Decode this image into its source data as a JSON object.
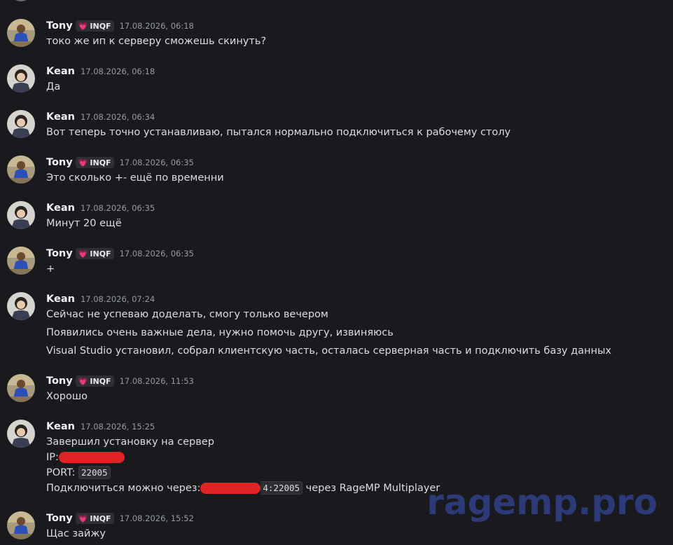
{
  "users": {
    "tony": {
      "name": "Tony",
      "tag": "INQF",
      "tag_icon": "heart-icon",
      "tag_color": "#f47fbd"
    },
    "kean": {
      "name": "Kean"
    }
  },
  "messages": [
    {
      "author": "Tony",
      "tag": "INQF",
      "time": "17.08.2026, 06:18",
      "lines": [
        "токо же ип к серверу сможешь скинуть?"
      ]
    },
    {
      "author": "Kean",
      "time": "17.08.2026, 06:18",
      "lines": [
        "Да"
      ]
    },
    {
      "author": "Kean",
      "time": "17.08.2026, 06:34",
      "lines": [
        "Вот теперь точно устанавливаю, пытался нормально подключиться к рабочему столу"
      ]
    },
    {
      "author": "Tony",
      "tag": "INQF",
      "time": "17.08.2026, 06:35",
      "lines": [
        "Это сколько +- ещё по временни"
      ]
    },
    {
      "author": "Kean",
      "time": "17.08.2026, 06:35",
      "lines": [
        "Минут 20 ещё"
      ]
    },
    {
      "author": "Tony",
      "tag": "INQF",
      "time": "17.08.2026, 06:35",
      "lines": [
        "+"
      ]
    },
    {
      "author": "Kean",
      "time": "17.08.2026, 07:24",
      "lines": [
        "Сейчас не успеваю доделать, смогу только вечером",
        "Появились очень важные дела, нужно помочь другу, извиняюсь",
        "Visual Studio установил, собрал клиентскую часть, осталась серверная часть и подключить базу данных"
      ]
    },
    {
      "author": "Tony",
      "tag": "INQF",
      "time": "17.08.2026, 11:53",
      "lines": [
        "Хорошо"
      ]
    },
    {
      "author": "Kean",
      "time": "17.08.2026, 15:25",
      "lines": {
        "l1": "Завершил установку на сервер",
        "ip_label": "IP:",
        "port_label": "PORT:",
        "port_value": "22005",
        "connect_label": "Подключиться можно через:",
        "connect_code_suffix": "4:22005",
        "connect_tail": "через RageMP Multiplayer"
      }
    },
    {
      "author": "Tony",
      "tag": "INQF",
      "time": "17.08.2026, 15:52",
      "lines": [
        "Щас зайжу"
      ]
    }
  ],
  "watermark": "ragemp.pro",
  "colors": {
    "background": "#1a1a1e",
    "redaction": "#e02424",
    "watermark": "#2d3a78",
    "tag_heart": "#f47fbd"
  }
}
